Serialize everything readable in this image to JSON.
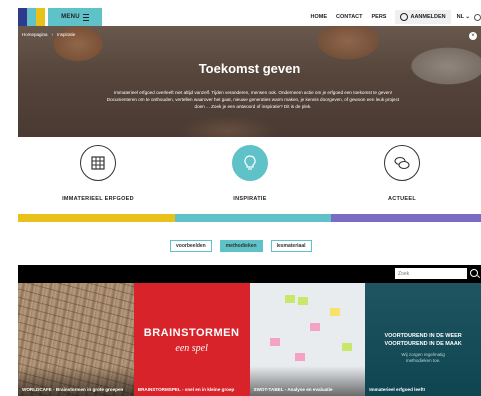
{
  "header": {
    "menu_label": "MENU",
    "nav": [
      "HOME",
      "CONTACT",
      "PERS"
    ],
    "login_label": "AANMELDEN",
    "language": "NL"
  },
  "hero": {
    "breadcrumb": [
      "Homepagina",
      "Inspiratie"
    ],
    "title": "Toekomst geven",
    "text": "Immaterieel erfgoed overleeft niet altijd vanzelf. Tijden veranderen, mensen ook. Onderneem actie om je erfgoed een toekomst te geven! Documenteren om te onthouden, vertellen waarover het gaat, nieuwe generaties warm maken, je kennis doorgeven, of gewoon een leuk project doen ... Zoek je een antwoord of inspiratie? Dit is de plek."
  },
  "categories": [
    {
      "label": "IMMATERIEEL ERFGOED",
      "icon": "grid-icon"
    },
    {
      "label": "INSPIRATIE",
      "icon": "lightbulb-icon"
    },
    {
      "label": "ACTUEEL",
      "icon": "chat-bubbles-icon"
    }
  ],
  "colors": {
    "teal": "#5fc2c9",
    "yellow": "#e8c21a",
    "purple": "#7b6bc4",
    "red": "#d8232a",
    "dark_teal": "#1f5561",
    "logo": [
      "#2e3a8c",
      "#5fc2c9",
      "#e8c21a"
    ]
  },
  "filters": [
    "voorbeelden",
    "methodieken",
    "lesmateriaal"
  ],
  "search": {
    "placeholder": "Zoek"
  },
  "cards": [
    {
      "caption": "WORLDCAFE - Brainstormen in grote groepen"
    },
    {
      "big": "BRAINSTORMEN",
      "sub": "een spel",
      "caption": "BRAINSTORMSPEL - snel en in kleine groep"
    },
    {
      "caption": "SWOT-TABEL - Analyse en evaluatie"
    },
    {
      "line1": "VOORTDUREND IN DE WEER",
      "line2": "VOORTDUREND IN DE MAAK",
      "line3": "Wij zorgen regelmatig methodieken toe.",
      "caption": "Immaterieel erfgoed leeft!"
    }
  ]
}
